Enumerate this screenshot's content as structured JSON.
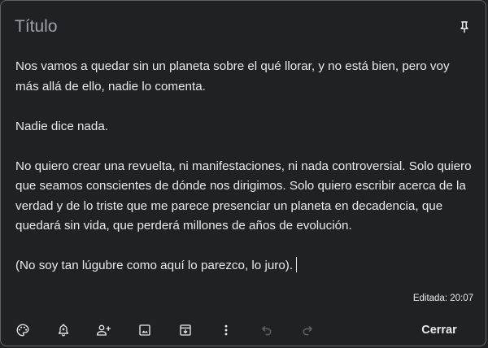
{
  "note": {
    "title_placeholder": "Título",
    "paragraphs": [
      "Nos vamos a quedar sin un planeta sobre el qué llorar, y no está bien, pero voy más allá de ello, nadie lo comenta.",
      "Nadie dice nada.",
      "No quiero crear una revuelta, ni manifestaciones, ni nada controversial. Solo quiero que seamos conscientes de dónde nos dirigimos. Solo quiero escribir acerca de la verdad y de lo triste que me parece presenciar un planeta en decadencia, que quedará sin vida, que perderá millones de años de evolución.",
      "(No soy tan lúgubre como aquí lo parezco, lo juro)."
    ],
    "edited_label": "Editada: 20:07"
  },
  "toolbar": {
    "icons": [
      "palette-icon",
      "reminder-bell-icon",
      "collaborator-icon",
      "image-icon",
      "archive-icon",
      "more-vert-icon",
      "undo-icon",
      "redo-icon"
    ],
    "close_label": "Cerrar"
  },
  "colors": {
    "background": "#202124",
    "border": "#5f6368",
    "text": "#e8eaed",
    "placeholder": "#9aa0a6",
    "icon": "#e8eaed",
    "icon_disabled": "#5f6368"
  }
}
